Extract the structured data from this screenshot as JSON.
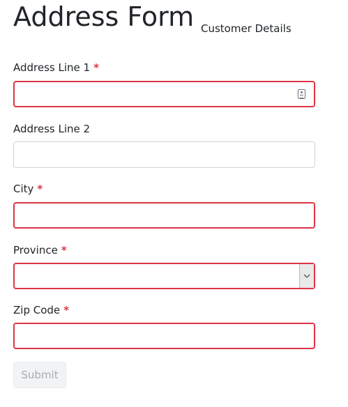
{
  "page": {
    "title": "Address Form",
    "subtitle": "Customer Details"
  },
  "form": {
    "required_marker": "*",
    "address_line_1": {
      "label": "Address Line 1",
      "value": "",
      "required": true,
      "invalid": true
    },
    "address_line_2": {
      "label": "Address Line 2",
      "value": "",
      "required": false,
      "invalid": false
    },
    "city": {
      "label": "City",
      "value": "",
      "required": true,
      "invalid": true
    },
    "province": {
      "label": "Province",
      "selected": "",
      "required": true,
      "invalid": true
    },
    "zip_code": {
      "label": "Zip Code",
      "value": "",
      "required": true,
      "invalid": true
    },
    "submit_label": "Submit",
    "submit_disabled": true
  },
  "icons": {
    "autofill": "contact-card-icon",
    "select_arrow": "chevron-down-icon"
  },
  "colors": {
    "invalid_border": "#dc3545",
    "required_marker": "#dc3545",
    "default_border": "#ced4da",
    "disabled_button_bg": "#f1f3f5",
    "disabled_button_text": "#a6acb3"
  }
}
